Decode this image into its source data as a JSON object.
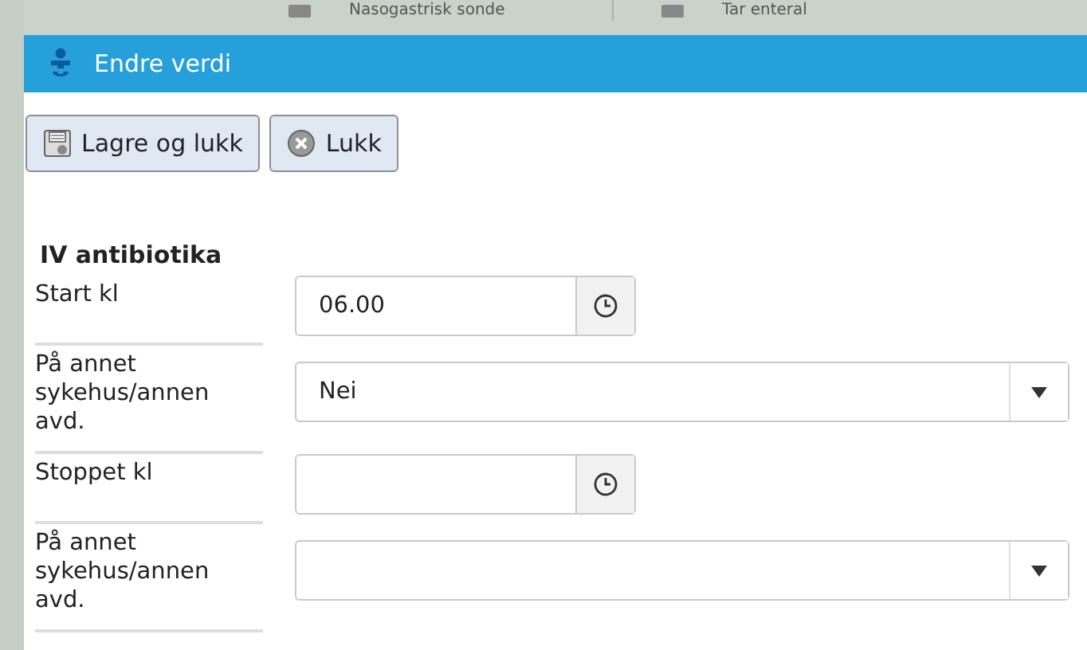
{
  "background": {
    "tabs": [
      "Nasogastrisk sonde",
      "Tar enteral"
    ]
  },
  "dialog": {
    "title": "Endre verdi",
    "buttons": [
      {
        "kind": "save",
        "label": "Lagre og lukk"
      },
      {
        "kind": "close",
        "label": "Lukk"
      }
    ],
    "section": "IV antibiotika",
    "fields": [
      {
        "kind": "time",
        "label": "Start kl",
        "value": "06.00"
      },
      {
        "kind": "select",
        "label": "På annet sykehus/annen avd.",
        "value": "Nei"
      },
      {
        "kind": "time",
        "label": "Stoppet kl"
      },
      {
        "kind": "select",
        "label": "På annet sykehus/annen avd."
      }
    ]
  }
}
